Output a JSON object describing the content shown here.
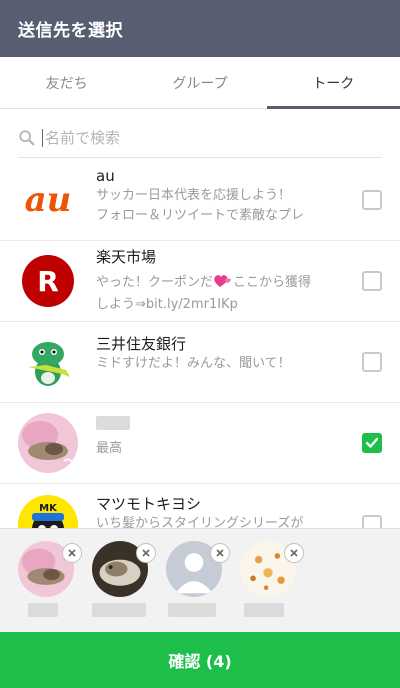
{
  "header": {
    "title": "送信先を選択"
  },
  "tabs": [
    {
      "label": "友だち",
      "active": false
    },
    {
      "label": "グループ",
      "active": false
    },
    {
      "label": "トーク",
      "active": true
    }
  ],
  "search": {
    "placeholder": "名前で検索",
    "value": ""
  },
  "rows": [
    {
      "name": "au",
      "sub1": "サッカー日本代表を応援しよう！",
      "sub2": "フォロー＆リツイートで素敵なプレ",
      "checked": false,
      "avatar_icon": "au-logo-icon"
    },
    {
      "name": "楽天市場",
      "sub1": "やった！クーポンだ",
      "sub1b": "ここから獲得",
      "sub2": "しよう⇒bit.ly/2mr1IKp",
      "checked": false,
      "avatar_icon": "rakuten-logo-icon"
    },
    {
      "name": "三井住友銀行",
      "sub1": "ミドすけだよ！みんな、聞いて！",
      "checked": false,
      "avatar_icon": "midosuke-mascot-icon"
    },
    {
      "name": "",
      "sub1": "最高",
      "checked": true,
      "avatar_icon": "cat-photo-avatar"
    },
    {
      "name": "マツモトキヨシ",
      "sub1": "いち髪からスタイリングシリーズが",
      "checked": false,
      "avatar_icon": "matsukiyo-mascot-icon"
    }
  ],
  "selected_count": 4,
  "confirm": {
    "label": "確認 (4)"
  },
  "colors": {
    "header": "#575e71",
    "accent": "#1dbf4a",
    "au_orange": "#eb5505",
    "rakuten_red": "#bf0000"
  }
}
